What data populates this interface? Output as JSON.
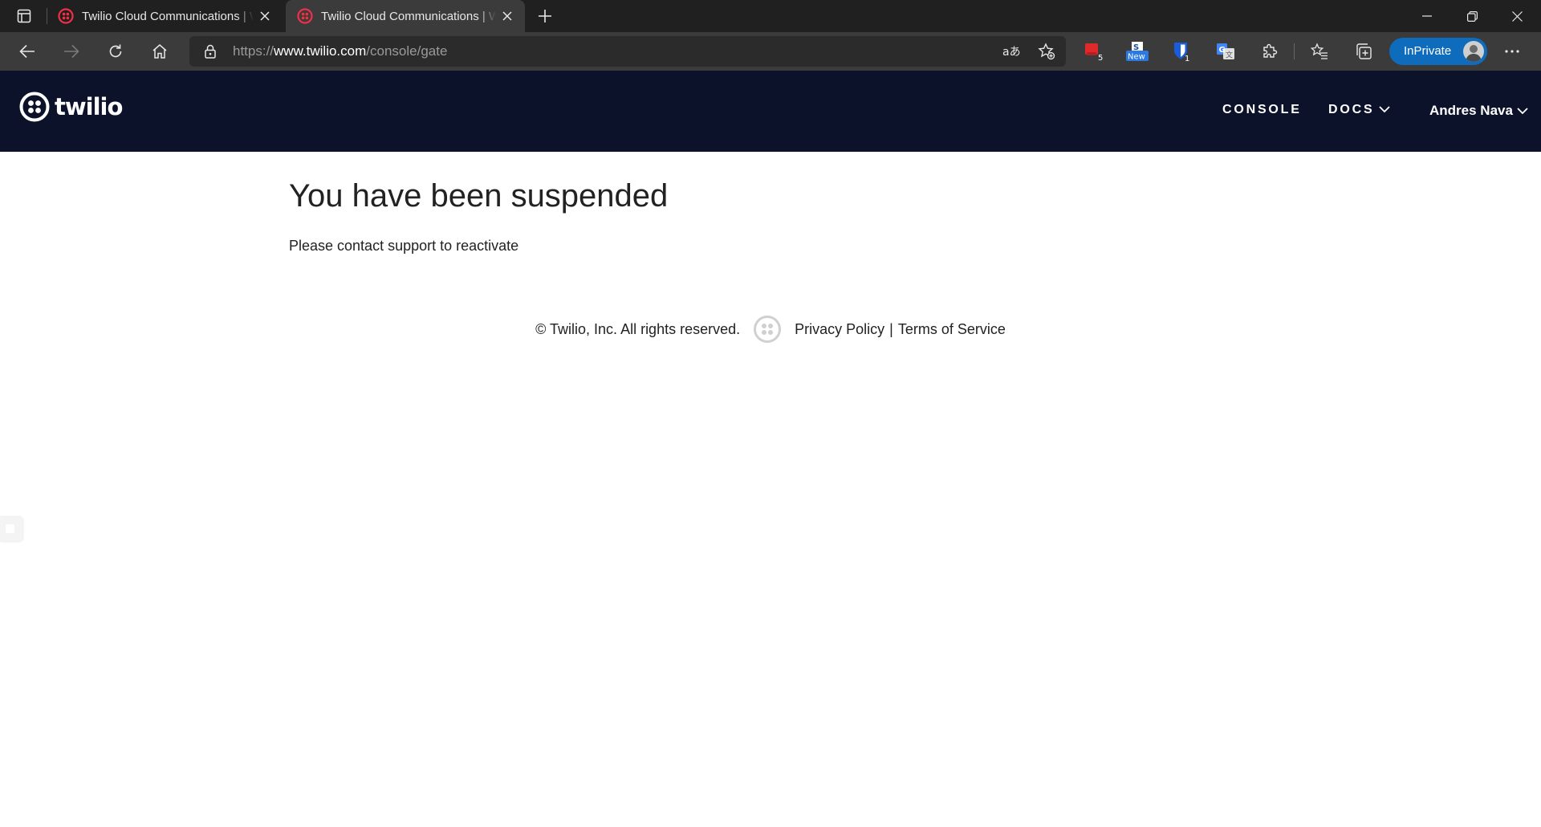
{
  "browser": {
    "tabs": [
      {
        "title": "Twilio Cloud Communications | W",
        "active": false
      },
      {
        "title": "Twilio Cloud Communications | W",
        "active": true
      }
    ],
    "url": {
      "scheme": "https://",
      "host": "www.twilio.com",
      "path": "/console/gate"
    },
    "extensions": [
      {
        "icon": "red-extension-icon",
        "badge": "5"
      },
      {
        "icon": "news-extension-icon",
        "badge": "New"
      },
      {
        "icon": "bitwarden-shield-icon",
        "badge": "1"
      },
      {
        "icon": "translate-extension-icon",
        "badge": ""
      }
    ],
    "inprivate_label": "InPrivate",
    "colors": {
      "tabbar": "#202020",
      "toolbar": "#3b3b3b",
      "inprivate": "#0f6cbd"
    }
  },
  "header": {
    "logo_text": "twilio",
    "nav": {
      "console": "CONSOLE",
      "docs": "DOCS",
      "user": "Andres Nava"
    },
    "background": "#0d122b"
  },
  "main": {
    "title": "You have been suspended",
    "message": "Please contact support to reactivate"
  },
  "footer": {
    "copyright": "© Twilio, Inc. All rights reserved.",
    "privacy": "Privacy Policy",
    "separator": "|",
    "terms": "Terms of Service"
  }
}
